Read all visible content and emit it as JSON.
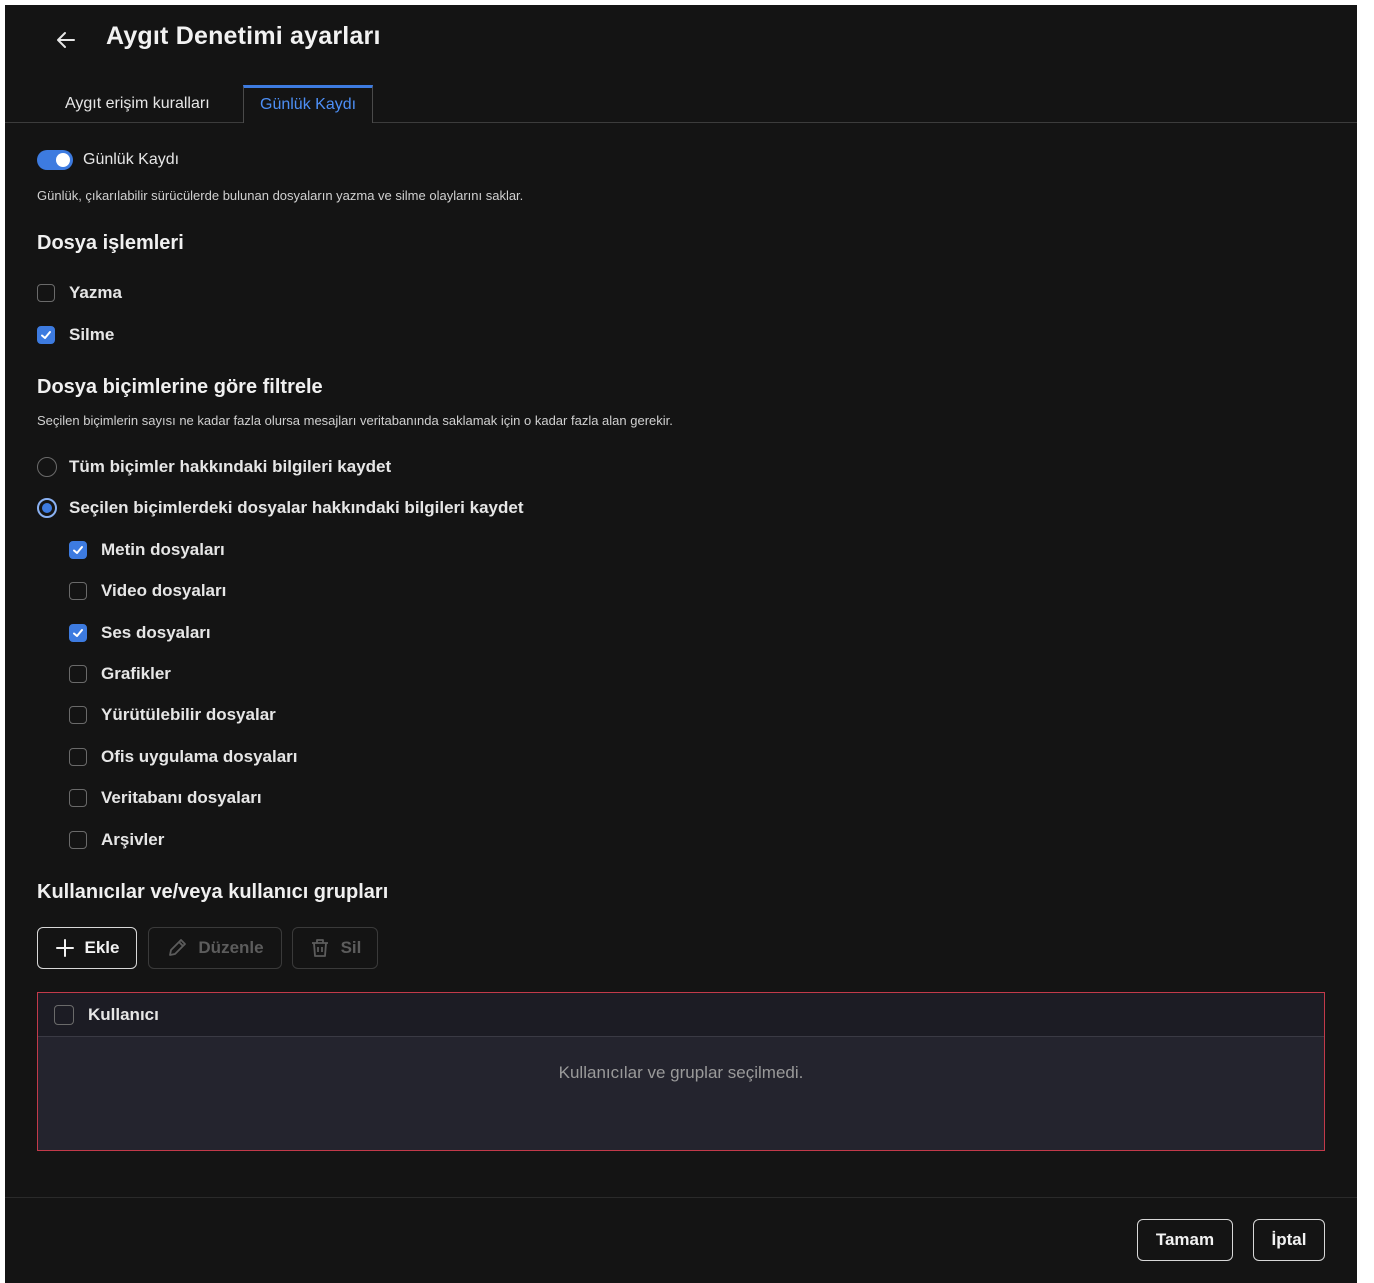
{
  "header": {
    "title": "Aygıt Denetimi ayarları"
  },
  "tabs": [
    {
      "label": "Aygıt erişim kuralları",
      "active": false
    },
    {
      "label": "Günlük Kaydı",
      "active": true
    }
  ],
  "logging": {
    "toggle_label": "Günlük Kaydı",
    "toggle_on": true,
    "description": "Günlük, çıkarılabilir sürücülerde bulunan dosyaların yazma ve silme olaylarını saklar."
  },
  "file_ops": {
    "title": "Dosya işlemleri",
    "items": [
      {
        "label": "Yazma",
        "checked": false
      },
      {
        "label": "Silme",
        "checked": true
      }
    ]
  },
  "format_filter": {
    "title": "Dosya biçimlerine göre filtrele",
    "description": "Seçilen biçimlerin sayısı ne kadar fazla olursa mesajları veritabanında saklamak için o kadar fazla alan gerekir.",
    "radios": [
      {
        "label": "Tüm biçimler hakkındaki bilgileri kaydet",
        "checked": false
      },
      {
        "label": "Seçilen biçimlerdeki dosyalar hakkındaki bilgileri kaydet",
        "checked": true
      }
    ],
    "formats": [
      {
        "label": "Metin dosyaları",
        "checked": true
      },
      {
        "label": "Video dosyaları",
        "checked": false
      },
      {
        "label": "Ses dosyaları",
        "checked": true
      },
      {
        "label": "Grafikler",
        "checked": false
      },
      {
        "label": "Yürütülebilir dosyalar",
        "checked": false
      },
      {
        "label": "Ofis uygulama dosyaları",
        "checked": false
      },
      {
        "label": "Veritabanı dosyaları",
        "checked": false
      },
      {
        "label": "Arşivler",
        "checked": false
      }
    ]
  },
  "users": {
    "title": "Kullanıcılar ve/veya kullanıcı grupları",
    "add_label": "Ekle",
    "edit_label": "Düzenle",
    "delete_label": "Sil",
    "column_user": "Kullanıcı",
    "empty_text": "Kullanıcılar ve gruplar seçilmedi."
  },
  "footer": {
    "ok_label": "Tamam",
    "cancel_label": "İptal"
  },
  "colors": {
    "accent": "#3d7be0",
    "background": "#141414",
    "error_border": "#c23a4a"
  }
}
